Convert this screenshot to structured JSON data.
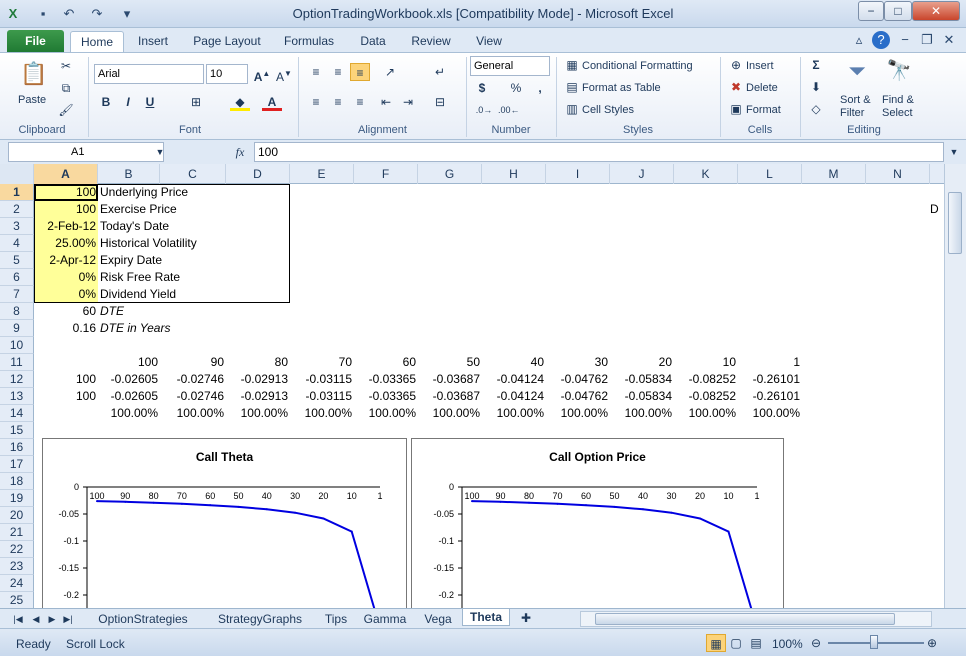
{
  "window": {
    "title": "OptionTradingWorkbook.xls  [Compatibility Mode]  -  Microsoft Excel",
    "buttons": {
      "minimize": "−",
      "maximize": "□",
      "close": "✕"
    }
  },
  "ribbon_tabs": {
    "file": "File",
    "tabs": [
      "Home",
      "Insert",
      "Page Layout",
      "Formulas",
      "Data",
      "Review",
      "View"
    ]
  },
  "ribbon": {
    "clipboard": {
      "label": "Clipboard",
      "paste": "Paste"
    },
    "font": {
      "label": "Font",
      "name": "Arial",
      "size": "10",
      "bold": "B",
      "italic": "I",
      "underline": "U"
    },
    "alignment": {
      "label": "Alignment"
    },
    "number": {
      "label": "Number",
      "format": "General",
      "currency": "$",
      "percent": "%",
      "comma": ","
    },
    "styles": {
      "label": "Styles",
      "conditional": "Conditional Formatting",
      "format_table": "Format as Table",
      "cell_styles": "Cell Styles"
    },
    "cells": {
      "label": "Cells",
      "insert": "Insert",
      "delete": "Delete",
      "format": "Format"
    },
    "editing": {
      "label": "Editing",
      "sort": "Sort &",
      "filter": "Filter",
      "find": "Find &",
      "select": "Select",
      "sigma": "Σ"
    }
  },
  "formula_bar": {
    "name_box": "A1",
    "fx": "fx",
    "value": "100"
  },
  "columns": [
    "A",
    "B",
    "C",
    "D",
    "E",
    "F",
    "G",
    "H",
    "I",
    "J",
    "K",
    "L",
    "M",
    "N"
  ],
  "rows": [
    "1",
    "2",
    "3",
    "4",
    "5",
    "6",
    "7",
    "8",
    "9",
    "10",
    "11",
    "12",
    "13",
    "14",
    "15",
    "16",
    "17",
    "18",
    "19",
    "20",
    "21",
    "22",
    "23",
    "24",
    "25"
  ],
  "inputs": [
    {
      "value": "100",
      "label": "Underlying Price"
    },
    {
      "value": "100",
      "label": "Exercise Price"
    },
    {
      "value": "2-Feb-12",
      "label": "Today's Date"
    },
    {
      "value": "25.00%",
      "label": "Historical Volatility"
    },
    {
      "value": "2-Apr-12",
      "label": "Expiry Date"
    },
    {
      "value": "0%",
      "label": "Risk Free Rate"
    },
    {
      "value": "0%",
      "label": "Dividend Yield"
    }
  ],
  "dte": {
    "value": "60",
    "label": "DTE"
  },
  "dte_years": {
    "value": "0.16",
    "label": "DTE in Years"
  },
  "n1_text": "D",
  "table": {
    "header": [
      "100",
      "90",
      "80",
      "70",
      "60",
      "50",
      "40",
      "30",
      "20",
      "10",
      "1"
    ],
    "row12": {
      "a": "100",
      "values": [
        "-0.02605",
        "-0.02746",
        "-0.02913",
        "-0.03115",
        "-0.03365",
        "-0.03687",
        "-0.04124",
        "-0.04762",
        "-0.05834",
        "-0.08252",
        "-0.26101"
      ]
    },
    "row13": {
      "a": "100",
      "values": [
        "-0.02605",
        "-0.02746",
        "-0.02913",
        "-0.03115",
        "-0.03365",
        "-0.03687",
        "-0.04124",
        "-0.04762",
        "-0.05834",
        "-0.08252",
        "-0.26101"
      ]
    },
    "row14": [
      "100.00%",
      "100.00%",
      "100.00%",
      "100.00%",
      "100.00%",
      "100.00%",
      "100.00%",
      "100.00%",
      "100.00%",
      "100.00%",
      "100.00%"
    ]
  },
  "chart_data": [
    {
      "type": "line",
      "title": "Call Theta",
      "x": [
        "100",
        "90",
        "80",
        "70",
        "60",
        "50",
        "40",
        "30",
        "20",
        "10",
        "1"
      ],
      "y_ticks": [
        "0",
        "-0.05",
        "-0.1",
        "-0.15",
        "-0.2"
      ],
      "ylim": [
        -0.2,
        0
      ],
      "series": [
        {
          "values": [
            -0.02605,
            -0.02746,
            -0.02913,
            -0.03115,
            -0.03365,
            -0.03687,
            -0.04124,
            -0.04762,
            -0.05834,
            -0.08252,
            -0.26101
          ]
        }
      ],
      "color": "#0000e0"
    },
    {
      "type": "line",
      "title": "Call Option Price",
      "x": [
        "100",
        "90",
        "80",
        "70",
        "60",
        "50",
        "40",
        "30",
        "20",
        "10",
        "1"
      ],
      "y_ticks": [
        "0",
        "-0.05",
        "-0.1",
        "-0.15",
        "-0.2"
      ],
      "ylim": [
        -0.2,
        0
      ],
      "series": [
        {
          "values": [
            -0.02605,
            -0.02746,
            -0.02913,
            -0.03115,
            -0.03365,
            -0.03687,
            -0.04124,
            -0.04762,
            -0.05834,
            -0.08252,
            -0.26101
          ]
        }
      ],
      "color": "#0000e0"
    }
  ],
  "sheet_tabs": [
    "OptionStrategies",
    "StrategyGraphs",
    "Tips",
    "Gamma",
    "Vega",
    "Theta"
  ],
  "active_sheet": "Theta",
  "status": {
    "ready": "Ready",
    "scroll_lock": "Scroll Lock",
    "zoom": "100%"
  }
}
